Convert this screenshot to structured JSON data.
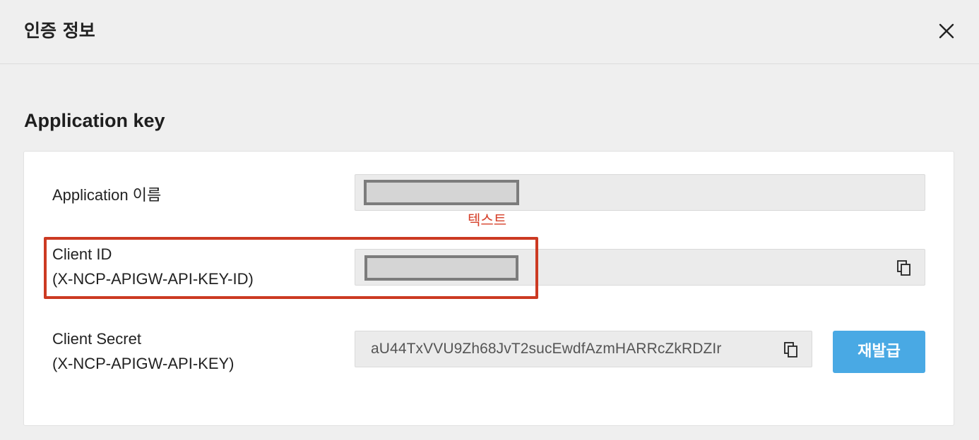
{
  "dialog": {
    "title": "인증 정보",
    "close_icon": "close-icon"
  },
  "section": {
    "title": "Application key"
  },
  "fields": {
    "app_name": {
      "label": "Application 이름",
      "value_masked": true
    },
    "annotation": {
      "text": "텍스트",
      "color": "#d6402a"
    },
    "client_id": {
      "label_line1": "Client ID",
      "label_line2": "(X-NCP-APIGW-API-KEY-ID)",
      "value_masked": true,
      "copy_icon": "copy-icon",
      "highlight_color": "#cc3a22"
    },
    "client_secret": {
      "label_line1": "Client Secret",
      "label_line2": "(X-NCP-APIGW-API-KEY)",
      "value": "aU44TxVVU9Zh68JvT2sucEwdfAzmHARRcZkRDZIr",
      "copy_icon": "copy-icon",
      "reissue_label": "재발급",
      "reissue_color": "#49a9e4"
    }
  }
}
